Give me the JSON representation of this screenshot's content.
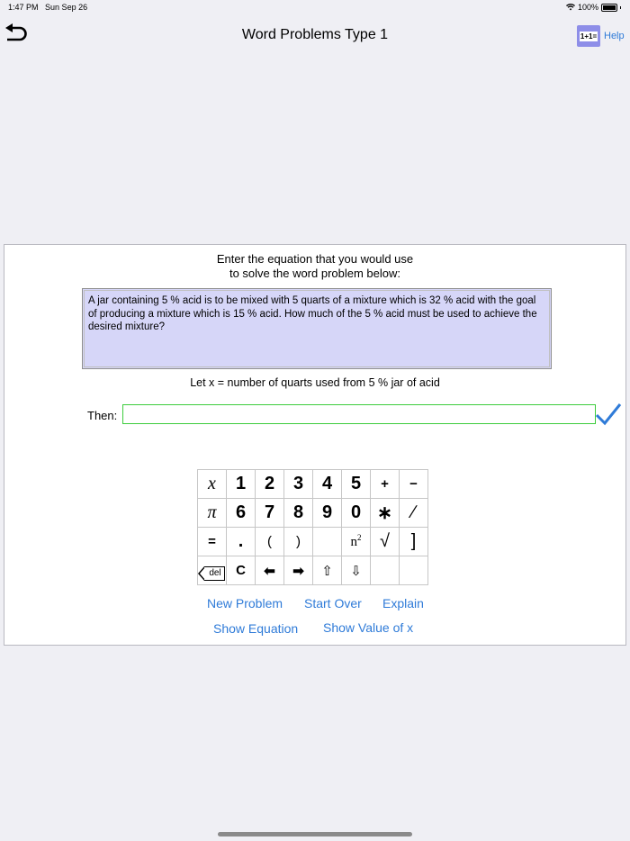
{
  "status_bar": {
    "time": "1:47 PM",
    "date": "Sun Sep 26",
    "battery": "100%"
  },
  "nav": {
    "title": "Word Problems Type 1",
    "calc_icon_label": "1+1=",
    "help_label": "Help"
  },
  "instructions": {
    "line1": "Enter the equation that you would use",
    "line2": "to solve the word problem below:"
  },
  "problem_text": "A jar containing 5 % acid is to be mixed with 5 quarts of a mixture which is 32 % acid with the goal of producing a mixture which is 15 % acid.  How much of the 5 % acid must be used to achieve the desired mixture?",
  "let_text": "Let x = number of quarts used from 5 % jar of acid",
  "then_label": "Then:",
  "answer": {
    "value": "",
    "placeholder": ""
  },
  "keypad": {
    "row1": [
      "x",
      "1",
      "2",
      "3",
      "4",
      "5",
      "+",
      "−"
    ],
    "row2": [
      "π",
      "6",
      "7",
      "8",
      "9",
      "0",
      "∗",
      "∕"
    ],
    "row3": [
      "=",
      ".",
      "(",
      ")",
      "",
      "n",
      "√",
      "]"
    ],
    "n_exponent": "2",
    "del_label": "del",
    "clear_label": "C",
    "left_arrow": "⬅",
    "right_arrow": "➡",
    "up_arrow": "⇧",
    "down_arrow": "⇩"
  },
  "links": {
    "new_problem": "New Problem",
    "start_over": "Start Over",
    "explain": "Explain",
    "show_equation": "Show Equation",
    "show_value": "Show Value of x"
  },
  "colors": {
    "accent": "#2f7bd8",
    "problem_bg": "#d6d6f8",
    "input_border": "#3ccc3c",
    "check": "#2f7bd8"
  }
}
